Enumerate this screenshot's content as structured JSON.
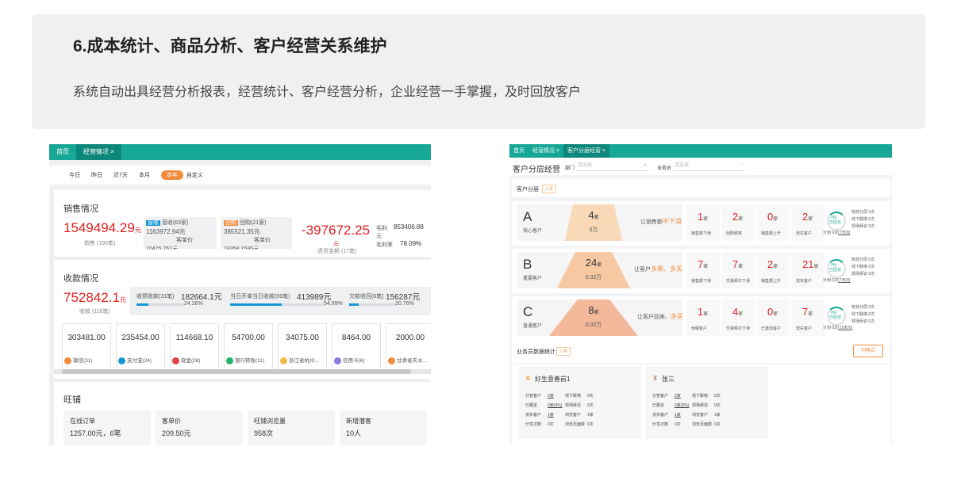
{
  "banner": {
    "title": "6.成本统计、商品分析、客户经营关系维护",
    "desc": "系统自动出具经营分析报表，经营统计、客户经营分析，企业经营一手掌握，及时回放客户"
  },
  "left": {
    "tabs": [
      "首页",
      "经营情况 ×"
    ],
    "filters": [
      "今日",
      "昨日",
      "近7天",
      "本月",
      "本年",
      "自定义"
    ],
    "sales": {
      "title": "销售情况",
      "amount": "1549494.29",
      "unit": "元",
      "count": "销售 (190笔)",
      "p1_label": "营收(63家)",
      "p1_badge": "营收",
      "p1_value": "1163972.94元",
      "p1_sub": "客单价",
      "p1_tail": "10475.761元",
      "p2_label": "回购(21家)",
      "p2_badge": "回购",
      "p2_value": "385521.35元",
      "p2_sub": "客单价",
      "p2_tail": "18358.1595元",
      "refund": "-397672.25",
      "refund_unit": "元",
      "refund_label": "退货金额 (17笔)",
      "gross_label": "毛利",
      "gross_value": "853406.88",
      "gross_unit": "元",
      "rate_label": "毛利率",
      "rate_value": "78.09%"
    },
    "collect": {
      "title": "收款情况",
      "amount": "752842.1",
      "unit": "元",
      "count": "收款 (116笔)",
      "i1_label": "收预收款(31笔)",
      "i1_value": "182664.1元",
      "i1_pct": "24.26%",
      "i1_frac": 0.2426,
      "i2_label": "当日开单当日收款(59笔)",
      "i2_value": "413989元",
      "i2_pct": "54.99%",
      "i2_frac": 0.5499,
      "i3_label": "欠款收回(6笔)",
      "i3_value": "156287元",
      "i3_pct": "20.76%",
      "i3_frac": 0.2076
    },
    "payments": [
      {
        "value": "303481.00",
        "label": "微信(31)",
        "color": "#f08c3c"
      },
      {
        "value": "235454.00",
        "label": "支付宝(24)",
        "color": "#1597d6"
      },
      {
        "value": "114668.10",
        "label": "现金(28)",
        "color": "#e5404a"
      },
      {
        "value": "54700.00",
        "label": "银行转账(11)",
        "color": "#24b36b"
      },
      {
        "value": "34075.00",
        "label": "浙江省杭州...",
        "color": "#f2b84a"
      },
      {
        "value": "8464.00",
        "label": "信用卡(6)",
        "color": "#8b7be0"
      },
      {
        "value": "2000.00",
        "label": "甘肃省天水...",
        "color": "#f08c3c"
      }
    ],
    "shop": {
      "title": "旺铺",
      "items": [
        {
          "label": "在线订单",
          "value": "1257.00元，6笔"
        },
        {
          "label": "客单价",
          "value": "209.50元"
        },
        {
          "label": "旺铺浏览量",
          "value": "958次"
        },
        {
          "label": "新增潜客",
          "value": "10人"
        }
      ]
    }
  },
  "right": {
    "tabs": [
      "首页",
      "经营情况 ×",
      "客户分层经营 ×"
    ],
    "page_title": "客户分层经营",
    "dept_label": "部门",
    "dept_ph": "请选择",
    "staff_label": "业务员",
    "staff_ph": "请选择",
    "seg_title": "客户分层",
    "seg_badge": "八月",
    "segments": [
      {
        "letter": "A",
        "name": "核心客户",
        "count": "4",
        "count_unit": "家",
        "amount": "0万",
        "hint_pre": "让销售额",
        "hint_red": "不下滑",
        "stats": [
          {
            "n": "1",
            "d": "销售额下滑"
          },
          {
            "n": "2",
            "d": "回购频率"
          },
          {
            "n": "0",
            "d": "销售额上升"
          },
          {
            "n": "2",
            "d": "流失客户"
          }
        ],
        "pct": "0%",
        "done": "已回访",
        "plan_pre": "计划 0次",
        "plan_link": "(7天/0)",
        "r1": "有效分层 0次",
        "r2": "线下联络 0次",
        "r3": "现场拜访 0次"
      },
      {
        "letter": "B",
        "name": "重要客户",
        "count": "24",
        "count_unit": "家",
        "amount": "0.32万",
        "hint_pre": "让客户",
        "hint_red": "多来、多买",
        "stats": [
          {
            "n": "7",
            "d": "销售额下滑"
          },
          {
            "n": "7",
            "d": "交易频次下滑"
          },
          {
            "n": "2",
            "d": "销售额上升"
          },
          {
            "n": "21",
            "d": "流失客户"
          }
        ],
        "pct": "0%",
        "done": "已回访",
        "plan_pre": "计划 0次",
        "plan_link": "(7天/0)",
        "r1": "有效分层 0次",
        "r2": "线下联络 0次",
        "r3": "现场拜访 0次"
      },
      {
        "letter": "C",
        "name": "普通客户",
        "count": "8",
        "count_unit": "家",
        "amount": "0.02万",
        "hint_pre": "让客户回来、",
        "hint_red": "多买",
        "stats": [
          {
            "n": "1",
            "d": "休眠客户"
          },
          {
            "n": "4",
            "d": "交易频次下滑"
          },
          {
            "n": "0",
            "d": "已激活客户"
          },
          {
            "n": "7",
            "d": "流失客户"
          }
        ],
        "pct": "0%",
        "done": "已回访",
        "plan_pre": "计划 0次",
        "plan_link": "(15天/0)",
        "r1": "有效分层 0次",
        "r2": "线下联络 0次",
        "r3": "现场拜访 0次"
      }
    ],
    "sales_title": "业务员数据统计",
    "sales_badge": "八月",
    "list_btn": "列表式",
    "employees": [
      {
        "name": "好生意善前1",
        "rows": [
          [
            "分管客户",
            "2家",
            "线下联络",
            "0次"
          ],
          [
            "已跟进",
            "0家(0%)",
            "现场拜访",
            "0次"
          ],
          [
            "流失客户",
            "1家",
            "浏览客户",
            "1家"
          ],
          [
            "分享次数",
            "0次",
            "浏览页面数",
            "0次"
          ]
        ]
      },
      {
        "name": "张三",
        "rows": [
          [
            "分管客户",
            "2家",
            "线下联络",
            "0次"
          ],
          [
            "已跟进",
            "0家(0%)",
            "现场拜访",
            "0次"
          ],
          [
            "流失客户",
            "1家",
            "浏览客户",
            "1家"
          ],
          [
            "分享次数",
            "0次",
            "浏览页面数",
            "0次"
          ]
        ]
      }
    ]
  }
}
